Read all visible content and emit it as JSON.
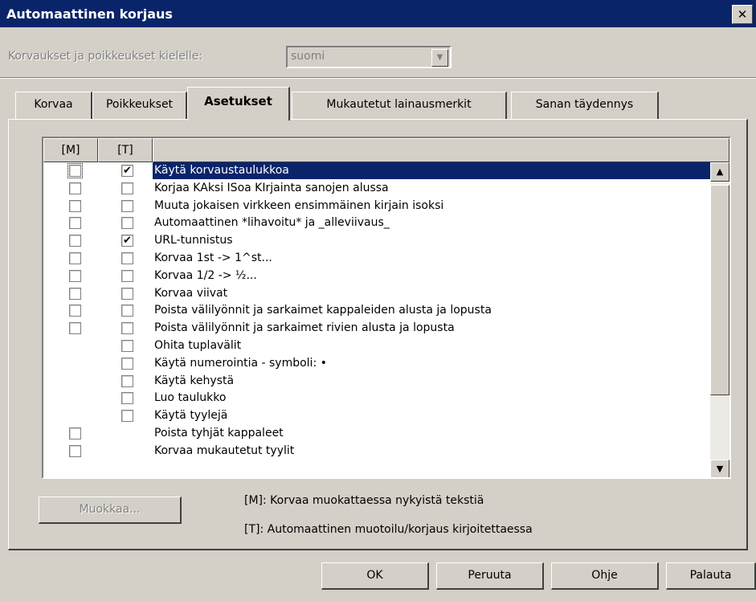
{
  "window": {
    "title": "Automaattinen korjaus",
    "close_glyph": "✕"
  },
  "language": {
    "label": "Korvaukset ja poikkeukset kielelle:",
    "value": "suomi"
  },
  "tabs": [
    {
      "label": "Korvaa"
    },
    {
      "label": "Poikkeukset"
    },
    {
      "label": "Asetukset",
      "active": true
    },
    {
      "label": "Mukautetut lainausmerkit"
    },
    {
      "label": "Sanan täydennys"
    }
  ],
  "columns": {
    "m": "[M]",
    "t": "[T]"
  },
  "options": [
    {
      "label": "Käytä korvaustaulukkoa",
      "m": false,
      "t": true,
      "selected": true
    },
    {
      "label": "Korjaa KAksi ISoa KIrjainta sanojen alussa",
      "m": false,
      "t": false
    },
    {
      "label": "Muuta jokaisen virkkeen ensimmäinen kirjain isoksi",
      "m": false,
      "t": false
    },
    {
      "label": "Automaattinen *lihavoitu* ja _alleviivaus_",
      "m": false,
      "t": false
    },
    {
      "label": "URL-tunnistus",
      "m": false,
      "t": true
    },
    {
      "label": "Korvaa 1st -> 1^st...",
      "m": false,
      "t": false
    },
    {
      "label": "Korvaa 1/2 -> ½...",
      "m": false,
      "t": false
    },
    {
      "label": "Korvaa viivat",
      "m": false,
      "t": false
    },
    {
      "label": "Poista välilyönnit ja sarkaimet kappaleiden alusta ja lopusta",
      "m": false,
      "t": false
    },
    {
      "label": "Poista välilyönnit ja sarkaimet rivien alusta ja lopusta",
      "m": false,
      "t": false
    },
    {
      "label": "Ohita tuplavälit",
      "t": false
    },
    {
      "label": "Käytä numerointia - symboli: •",
      "t": false
    },
    {
      "label": "Käytä kehystä",
      "t": false
    },
    {
      "label": "Luo taulukko",
      "t": false
    },
    {
      "label": "Käytä tyylejä",
      "t": false
    },
    {
      "label": "Poista tyhjät kappaleet",
      "m": false
    },
    {
      "label": "Korvaa mukautetut tyylit",
      "m": false
    }
  ],
  "edit_button": {
    "label": "Muokkaa..."
  },
  "legend": {
    "m": "[M]: Korvaa muokattaessa nykyistä tekstiä",
    "t": "[T]: Automaattinen muotoilu/korjaus kirjoitettaessa"
  },
  "buttons": {
    "ok": "OK",
    "cancel": "Peruuta",
    "help": "Ohje",
    "reset": "Palauta"
  },
  "check_glyph": "✔",
  "scroll_up_glyph": "▲",
  "scroll_down_glyph": "▼",
  "combo_arrow_glyph": "▼"
}
